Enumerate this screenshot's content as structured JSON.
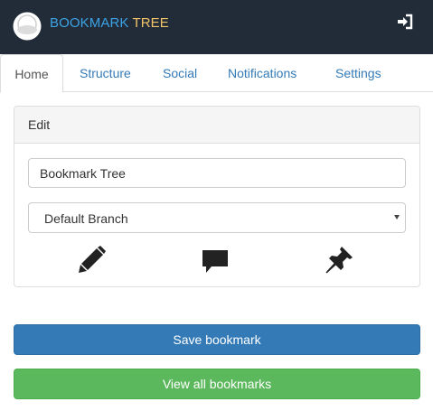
{
  "header": {
    "brand_part1": "BOOKMARK",
    "brand_part2": "TREE",
    "logo_icon": "user-avatar-icon",
    "logout_icon": "sign-in-icon"
  },
  "tabs": [
    {
      "label": "Home",
      "active": true
    },
    {
      "label": "Structure",
      "active": false
    },
    {
      "label": "Social",
      "active": false
    },
    {
      "label": "Notifications",
      "active": false
    },
    {
      "label": "Settings",
      "active": false
    }
  ],
  "panel": {
    "heading": "Edit",
    "bookmark_name_value": "Bookmark Tree",
    "branch_select_value": "Default Branch",
    "action_icons": [
      "pencil-icon",
      "comment-icon",
      "pushpin-icon"
    ]
  },
  "buttons": {
    "save_label": "Save bookmark",
    "view_all_label": "View all bookmarks"
  },
  "colors": {
    "header_bg": "#222b38",
    "brand_blue": "#3ba3e6",
    "brand_yellow": "#f2c46a",
    "primary": "#337ab7",
    "success": "#5cb85c"
  }
}
